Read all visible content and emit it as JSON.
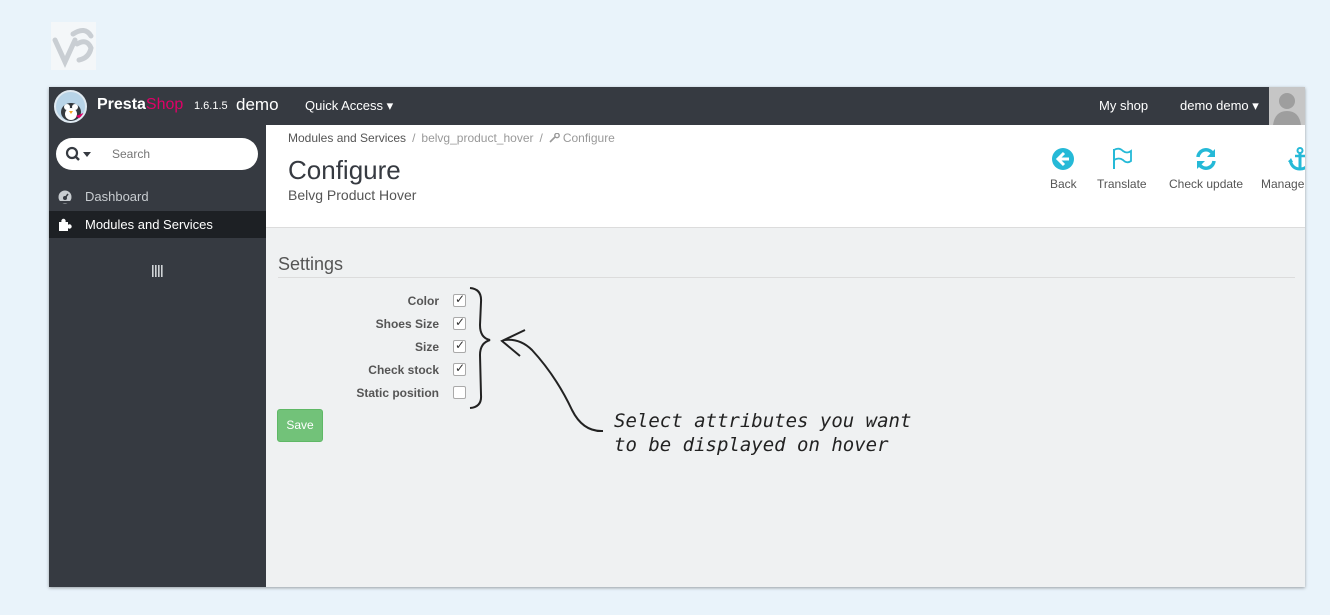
{
  "topbar": {
    "brand_presta": "Presta",
    "brand_shop": "Shop",
    "version": "1.6.1.5",
    "shop_name": "demo",
    "quick_access": "Quick Access ▾",
    "my_shop": "My shop",
    "user": "demo demo ▾"
  },
  "sidebar": {
    "search_placeholder": "Search",
    "items": [
      {
        "label": "Dashboard",
        "icon": "dashboard-icon"
      },
      {
        "label": "Modules and Services",
        "icon": "puzzle-icon"
      }
    ]
  },
  "header": {
    "breadcrumb": [
      "Modules and Services",
      "belvg_product_hover",
      "Configure"
    ],
    "title": "Configure",
    "subtitle": "Belvg Product Hover",
    "toolbar": [
      {
        "label": "Back",
        "icon": "back-arrow-icon"
      },
      {
        "label": "Translate",
        "icon": "flag-icon"
      },
      {
        "label": "Check update",
        "icon": "refresh-icon"
      },
      {
        "label": "Manage hooks",
        "icon": "anchor-icon"
      }
    ]
  },
  "form": {
    "section_title": "Settings",
    "fields": [
      {
        "label": "Color",
        "checked": true
      },
      {
        "label": "Shoes Size",
        "checked": true
      },
      {
        "label": "Size",
        "checked": true
      },
      {
        "label": "Check stock",
        "checked": true
      },
      {
        "label": "Static position",
        "checked": false
      }
    ],
    "save_label": "Save"
  },
  "annotation": {
    "line1": "Select attributes you want",
    "line2": "to be displayed on hover"
  },
  "colors": {
    "topbar": "#363a41",
    "accent": "#00aff0",
    "brand_pink": "#df0067",
    "save_green": "#72c279"
  }
}
